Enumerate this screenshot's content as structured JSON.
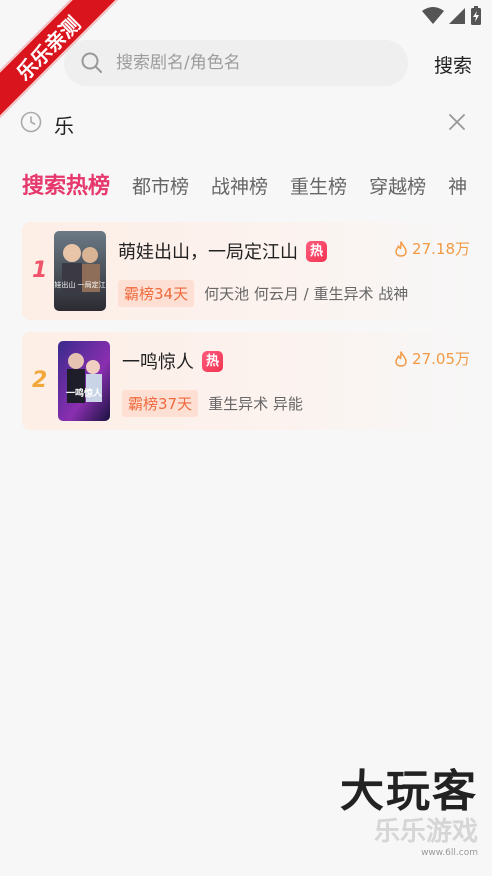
{
  "ribbon": {
    "text": "乐乐亲测"
  },
  "search": {
    "placeholder": "搜索剧名/角色名",
    "value": "",
    "button_label": "搜索"
  },
  "history": {
    "items": [
      {
        "label": "乐"
      }
    ]
  },
  "tabs": [
    {
      "label": "搜索热榜",
      "active": true
    },
    {
      "label": "都市榜"
    },
    {
      "label": "战神榜"
    },
    {
      "label": "重生榜"
    },
    {
      "label": "穿越榜"
    },
    {
      "label": "神"
    }
  ],
  "ranking": [
    {
      "rank": "1",
      "title": "萌娃出山，一局定江山",
      "hot_badge": "热",
      "heat": "27.18万",
      "tag": "霸榜34天",
      "info": "何天池 何云月 / 重生异术 战神",
      "poster_text": "萌娃出山 一局定江山"
    },
    {
      "rank": "2",
      "title": "一鸣惊人",
      "hot_badge": "热",
      "heat": "27.05万",
      "tag": "霸榜37天",
      "info": "重生异术 异能",
      "poster_text": "一鸣惊人"
    }
  ],
  "watermark": {
    "main": "大玩客",
    "sub": "乐乐游戏",
    "url": "www.6ll.com"
  },
  "colors": {
    "accent": "#e6386c",
    "rank1": "#f0546a",
    "rank2": "#f2a93b",
    "heat": "#f29a45",
    "tag_text": "#ef6a3e",
    "tag_bg": "#fde0d3"
  }
}
